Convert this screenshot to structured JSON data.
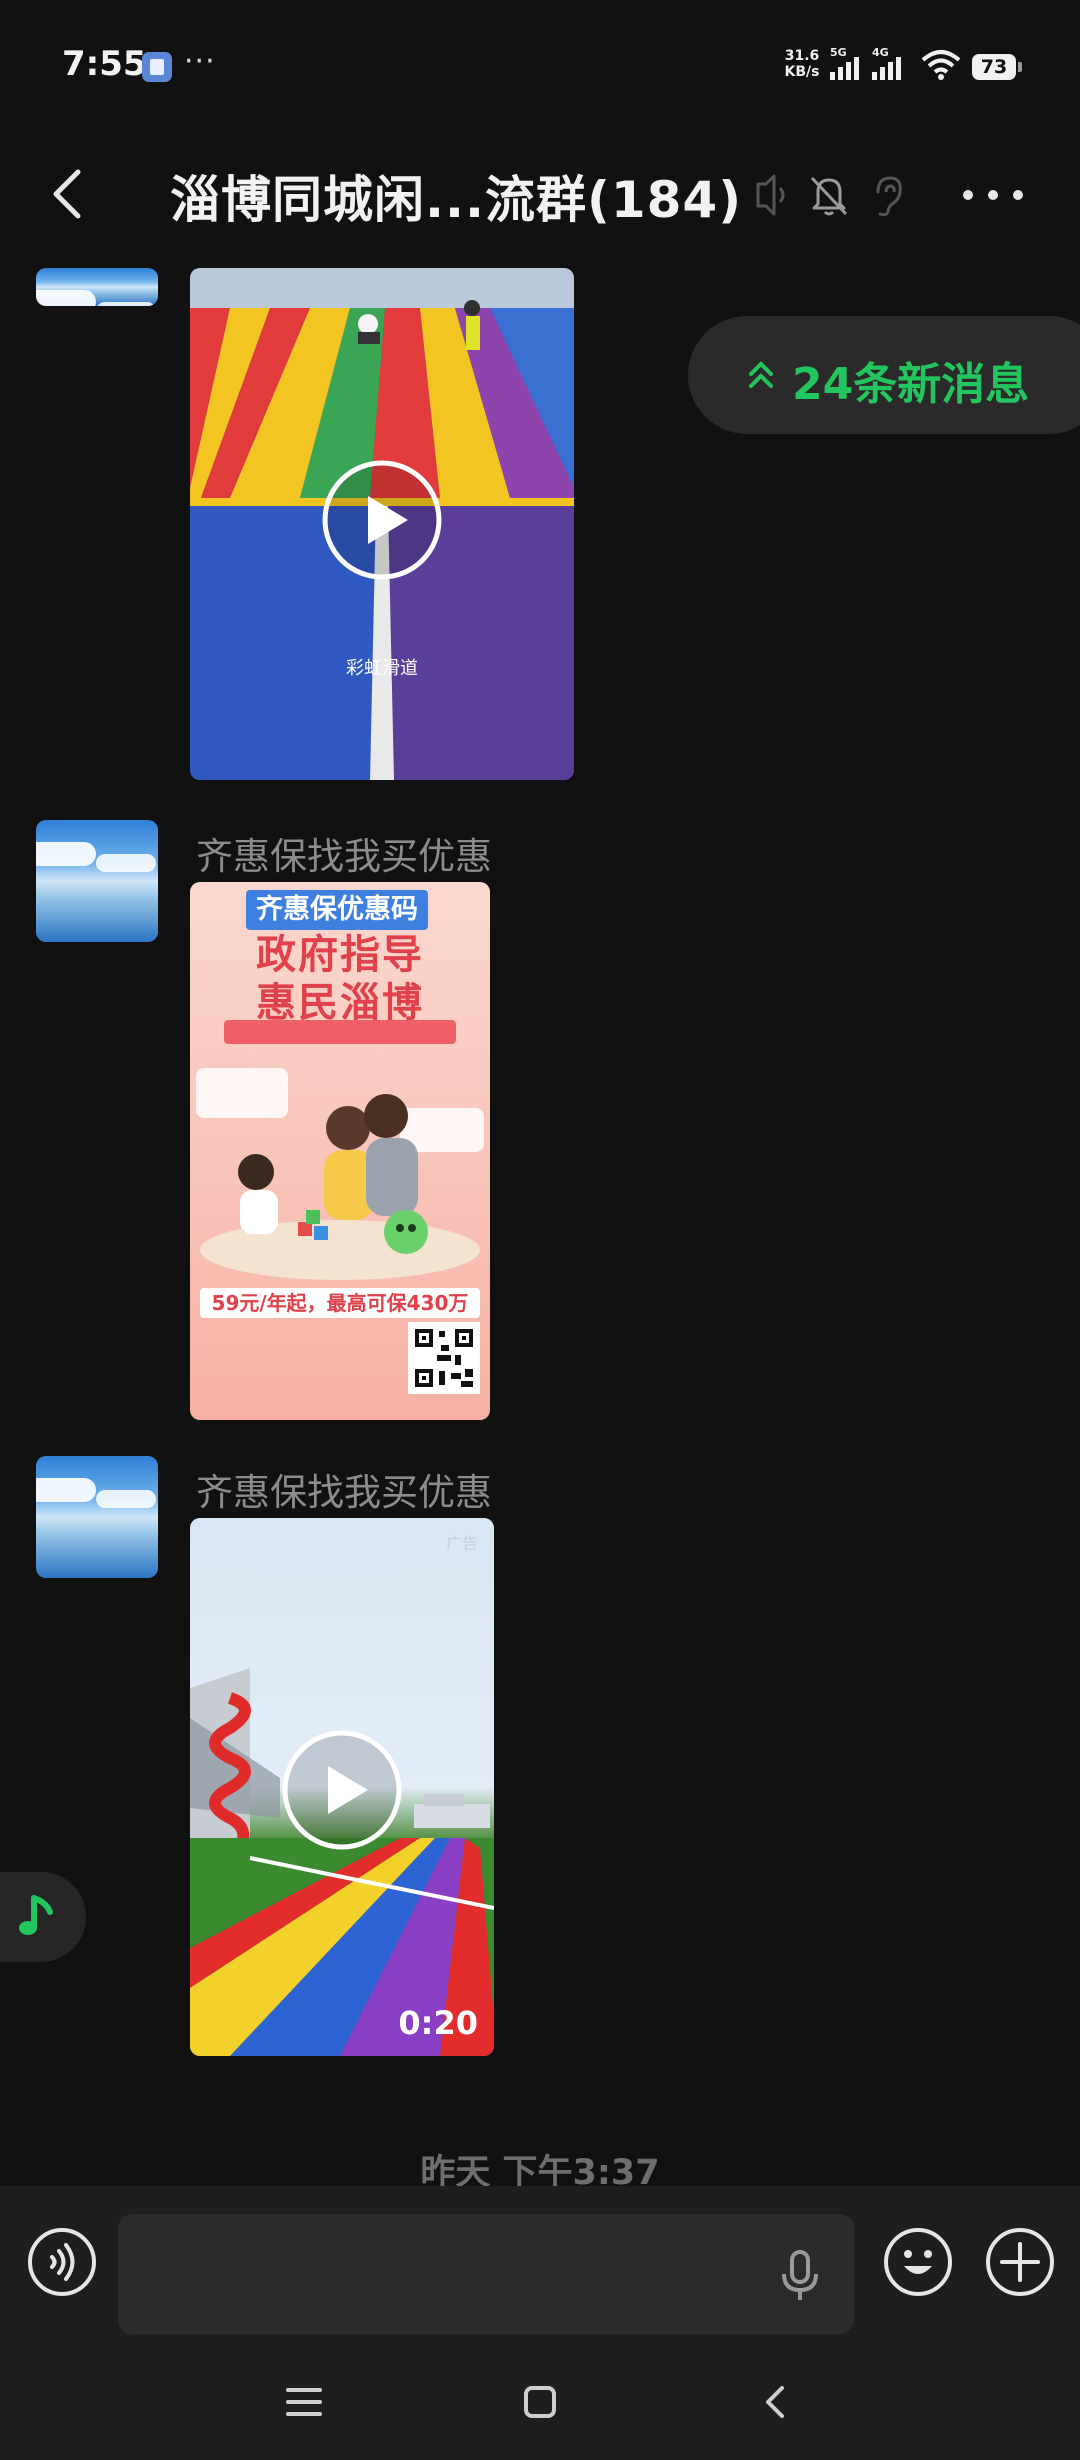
{
  "status_bar": {
    "time": "7:55",
    "more_dots": "···",
    "net_speed_value": "31.6",
    "net_speed_unit": "KB/s",
    "network_5g": "5G",
    "network_4g": "4G",
    "battery": "73"
  },
  "header": {
    "title": "淄博同城闲...流群(184)"
  },
  "new_messages": {
    "label": "24条新消息"
  },
  "messages": [
    {
      "type": "video",
      "caption": "彩虹滑道"
    },
    {
      "sender": "齐惠保找我买优惠",
      "type": "image",
      "poster": {
        "tag": "齐惠保优惠码",
        "title_line1": "政府指导",
        "title_line2": "惠民淄博",
        "price": "59元/年起，最高可保430万"
      }
    },
    {
      "sender": "齐惠保找我买优惠",
      "type": "video",
      "ad_mark": "广告",
      "duration": "0:20"
    }
  ],
  "timestamp": "昨天 下午3:37",
  "input": {
    "value": ""
  },
  "colors": {
    "background": "#111111",
    "accent_green": "#22c55e",
    "input_bar": "#1e1e1e"
  },
  "icons": {
    "back": "chevron-left-icon",
    "speaker_off": "speaker-icon",
    "mute": "bell-off-icon",
    "ear": "ear-icon",
    "more": "more-dots-icon",
    "voice": "voice-icon",
    "mic": "mic-icon",
    "emoji": "emoji-icon",
    "plus": "plus-icon",
    "music": "music-note-icon",
    "nav_menu": "menu-icon",
    "nav_home": "home-icon",
    "nav_back": "back-icon"
  }
}
